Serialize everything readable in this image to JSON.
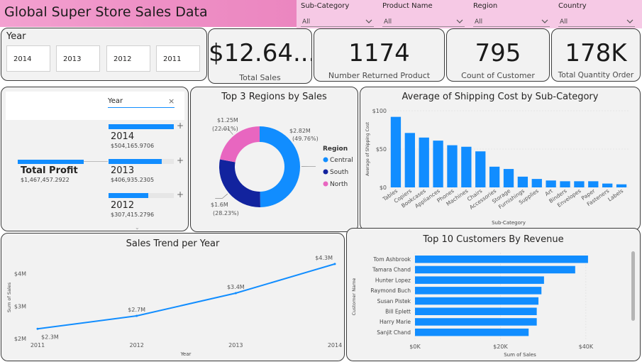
{
  "header": {
    "title": "Global Super Store Sales Data"
  },
  "filters": [
    {
      "label": "Sub-Category",
      "value": "All"
    },
    {
      "label": "Product Name",
      "value": "All"
    },
    {
      "label": "Region",
      "value": "All"
    },
    {
      "label": "Country",
      "value": "All"
    }
  ],
  "year_slicer": {
    "title": "Year",
    "options": [
      "2014",
      "2013",
      "2012",
      "2011"
    ]
  },
  "kpis": [
    {
      "value": "$12.64...",
      "label": "Total Sales"
    },
    {
      "value": "1174",
      "label": "Number Returned Product"
    },
    {
      "value": "795",
      "label": "Count of Customer"
    },
    {
      "value": "178K",
      "label": "Total Quantity Order"
    }
  ],
  "decomposition": {
    "breakdown_label": "Year",
    "root": {
      "label": "Total Profit",
      "value": "$1,467,457.2922"
    },
    "items": [
      {
        "label": "2014",
        "value": "$504,165.9706",
        "share": 1.0
      },
      {
        "label": "2013",
        "value": "$406,935.2305",
        "share": 0.81
      },
      {
        "label": "2012",
        "value": "$307,415.2796",
        "share": 0.61
      }
    ]
  },
  "colors": {
    "accent": "#118dff",
    "dark_blue": "#12239e",
    "pink": "#e66c37",
    "north": "#e866c0",
    "card_bg": "#f2f2f2"
  },
  "chart_data": [
    {
      "type": "pie",
      "title": "Top 3 Regions by Sales",
      "legend_title": "Region",
      "legend_placement": "right",
      "slices": [
        {
          "name": "Central",
          "value": 2.82,
          "label": "$2.82M",
          "percent": "(49.76%)",
          "color": "#118dff"
        },
        {
          "name": "South",
          "value": 1.6,
          "label": "$1.6M",
          "percent": "(28.23%)",
          "color": "#12239e"
        },
        {
          "name": "North",
          "value": 1.25,
          "label": "$1.25M",
          "percent": "(22.01%)",
          "color": "#e866c0"
        }
      ]
    },
    {
      "type": "bar",
      "title": "Average of Shipping Cost by Sub-Category",
      "xlabel": "Sub-Category",
      "ylabel": "Average of Shipping Cost",
      "ylim": [
        0,
        100
      ],
      "yticks": [
        "$0",
        "$50",
        "$100"
      ],
      "categories": [
        "Tables",
        "Copiers",
        "Bookcases",
        "Appliances",
        "Phones",
        "Machines",
        "Chairs",
        "Accessories",
        "Storage",
        "Furnishings",
        "Supplies",
        "Art",
        "Binders",
        "Envelopes",
        "Paper",
        "Fasteners",
        "Labels"
      ],
      "values": [
        92,
        71,
        65,
        61,
        55,
        53,
        47,
        27,
        24,
        14,
        11,
        9,
        8,
        8,
        8,
        5,
        4
      ]
    },
    {
      "type": "line",
      "title": "Sales Trend per Year",
      "xlabel": "Year",
      "ylabel": "Sum of Sales",
      "x": [
        "2011",
        "2012",
        "2013",
        "2014"
      ],
      "values": [
        2.3,
        2.7,
        3.4,
        4.3
      ],
      "data_labels": [
        "$2.3M",
        "$2.7M",
        "$3.4M",
        "$4.3M"
      ],
      "yticks": [
        {
          "value": 2,
          "label": "$2M"
        },
        {
          "value": 3,
          "label": "$3M"
        },
        {
          "value": 4,
          "label": "$4M"
        }
      ],
      "ylim": [
        2,
        4.45
      ]
    },
    {
      "type": "bar",
      "orientation": "horizontal",
      "title": "Top 10 Customers By Revenue",
      "xlabel": "Sum of Sales",
      "ylabel": "Customer Name",
      "xlim": [
        0,
        45000
      ],
      "xticks": [
        {
          "value": 0,
          "label": "$0K"
        },
        {
          "value": 20000,
          "label": "$20K"
        },
        {
          "value": 40000,
          "label": "$40K"
        }
      ],
      "categories": [
        "Tom Ashbrook",
        "Tamara Chand",
        "Hunter Lopez",
        "Raymond Buch",
        "Susan Pistek",
        "Bill Eplett",
        "Harry Marie",
        "Sanjit Chand"
      ],
      "values": [
        40500,
        37500,
        30200,
        29600,
        28900,
        28500,
        28500,
        26600
      ]
    }
  ]
}
